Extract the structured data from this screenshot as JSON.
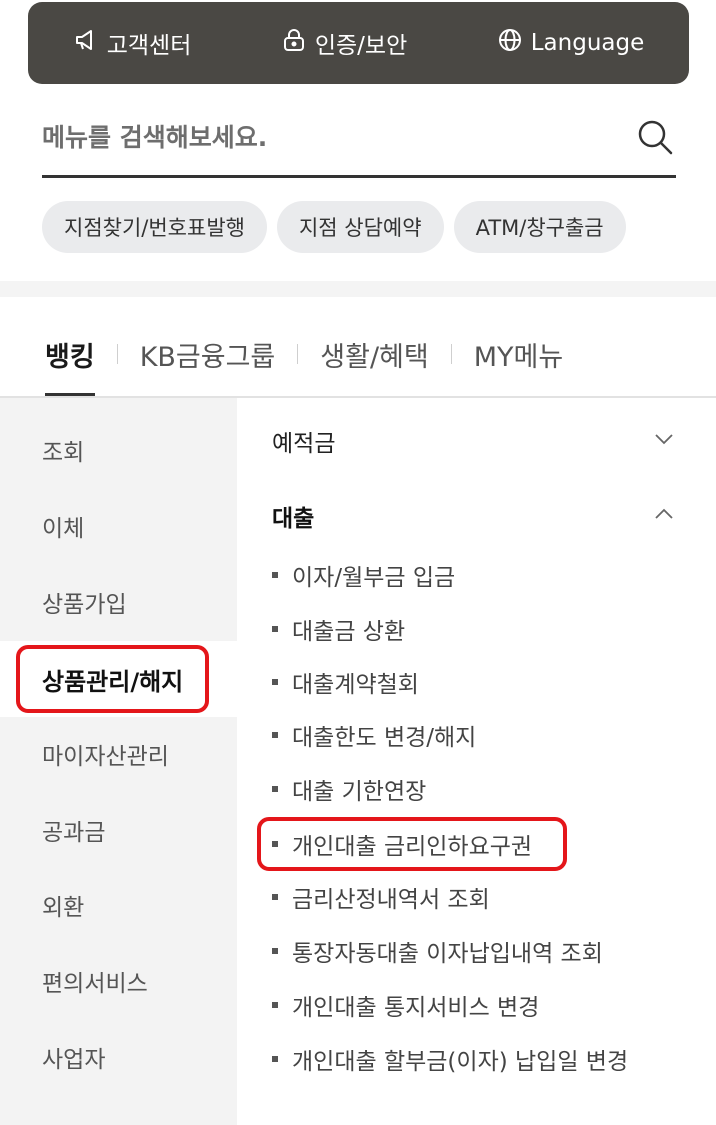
{
  "topbar": {
    "items": [
      {
        "label": "고객센터",
        "icon": "megaphone-icon"
      },
      {
        "label": "인증/보안",
        "icon": "lock-icon"
      },
      {
        "label": "Language",
        "icon": "globe-icon"
      }
    ]
  },
  "search": {
    "placeholder": "메뉴를 검색해보세요.",
    "icon": "search-icon"
  },
  "chips": [
    "지점찾기/번호표발행",
    "지점 상담예약",
    "ATM/창구출금"
  ],
  "tabs": {
    "items": [
      "뱅킹",
      "KB금융그룹",
      "생활/혜택",
      "MY메뉴"
    ],
    "active": "뱅킹"
  },
  "categories": {
    "items": [
      "조회",
      "이체",
      "상품가입",
      "상품관리/해지",
      "마이자산관리",
      "공과금",
      "외환",
      "편의서비스",
      "사업자"
    ],
    "active": "상품관리/해지"
  },
  "sections": [
    {
      "label": "예적금",
      "expanded": false,
      "icon": "chevron-down-icon"
    },
    {
      "label": "대출",
      "expanded": true,
      "icon": "chevron-up-icon",
      "items": [
        "이자/월부금 입금",
        "대출금 상환",
        "대출계약철회",
        "대출한도 변경/해지",
        "대출 기한연장",
        "개인대출 금리인하요구권",
        "금리산정내역서 조회",
        "통장자동대출 이자납입내역 조회",
        "개인대출 통지서비스 변경",
        "개인대출 할부금(이자) 납입일 변경"
      ]
    }
  ],
  "colors": {
    "topbar_bg": "#4a4844",
    "highlight": "#e4161a",
    "left_column_bg": "#f3f3f3"
  }
}
